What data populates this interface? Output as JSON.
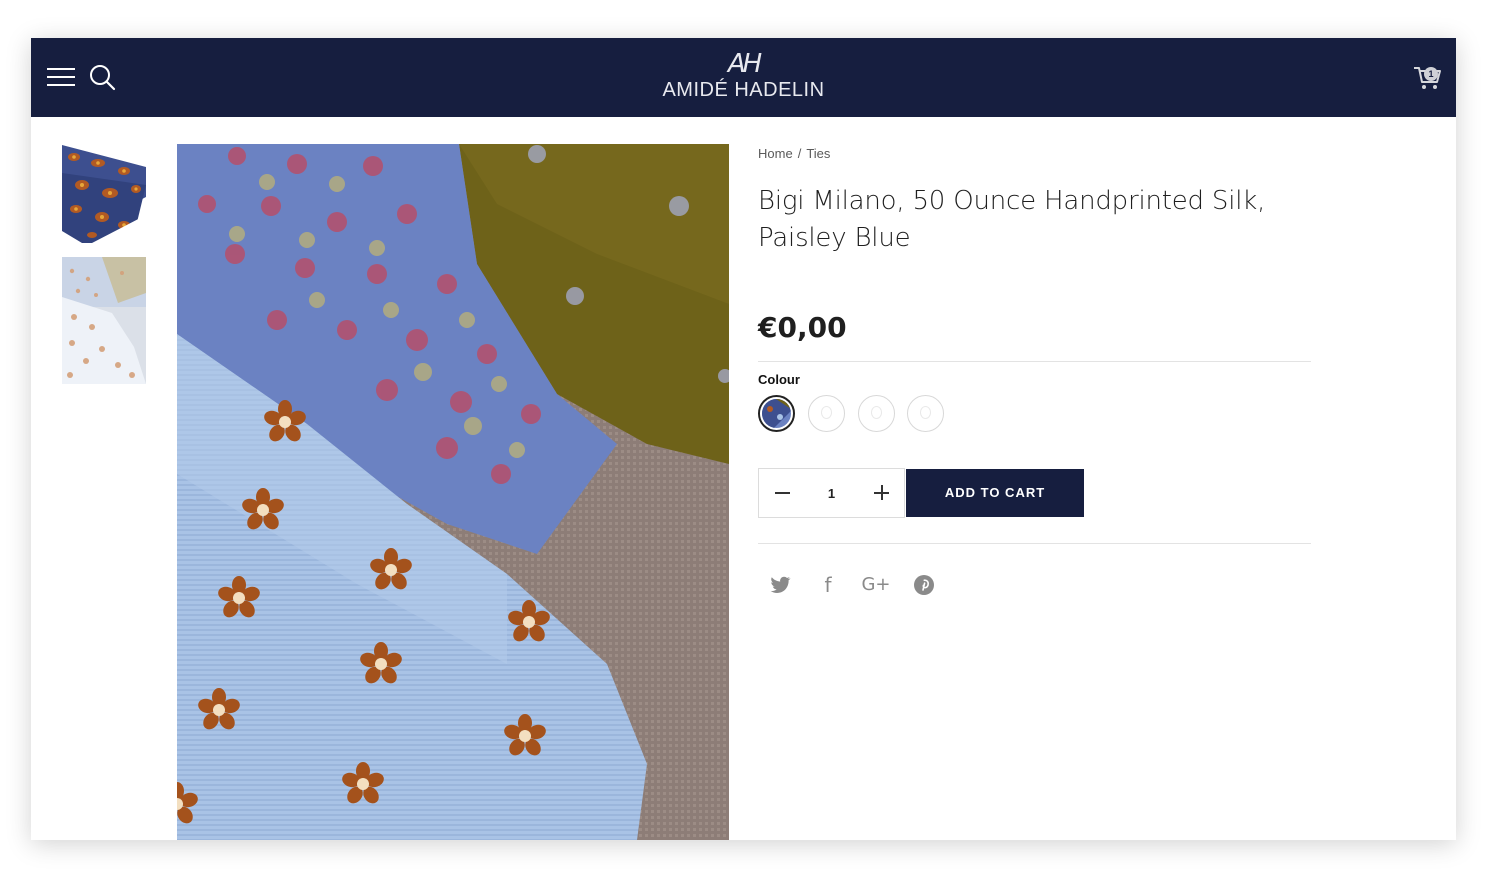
{
  "header": {
    "logo_mark": "AH",
    "logo_text": "AMIDÉ HADELIN",
    "cart_count": "1",
    "bg_color": "#161e3f",
    "icons": [
      "menu-icon",
      "search-icon",
      "cart-icon"
    ]
  },
  "gallery": {
    "thumbnails": [
      {
        "name": "paisley-tie-thumbnail"
      },
      {
        "name": "floral-ties-thumbnail"
      }
    ]
  },
  "breadcrumb": {
    "home": "Home",
    "separator": "/",
    "current": "Ties"
  },
  "product": {
    "title": "Bigi Milano, 50 Ounce Handprinted Silk, Paisley Blue",
    "price": "€0,00",
    "colour_label": "Colour",
    "swatch_count": 4,
    "selected_swatch": 1
  },
  "cart_form": {
    "quantity": "1",
    "add_to_cart_label": "ADD TO CART",
    "button_color": "#161e3f"
  },
  "share": {
    "icons": [
      "twitter-icon",
      "facebook-icon",
      "google-plus-icon",
      "pinterest-icon"
    ],
    "facebook_glyph": "f",
    "google_plus_glyph": "G+"
  }
}
